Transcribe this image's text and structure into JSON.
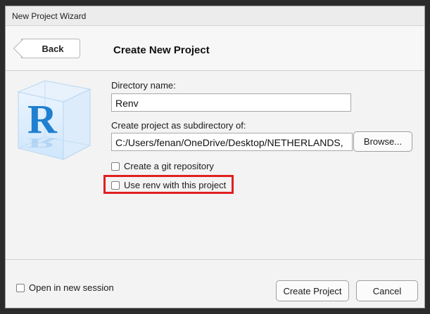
{
  "window": {
    "title": "New Project Wizard"
  },
  "header": {
    "back_label": "Back",
    "title": "Create New Project"
  },
  "logo": {
    "letter": "R"
  },
  "form": {
    "directory_label": "Directory name:",
    "directory_value": "Renv",
    "subdirectory_label": "Create project as subdirectory of:",
    "subdirectory_value": "C:/Users/fenan/OneDrive/Desktop/NETHERLANDS,",
    "browse_label": "Browse...",
    "git_label": "Create a git repository",
    "git_checked": false,
    "renv_label": "Use renv with this project",
    "renv_checked": false
  },
  "footer": {
    "new_session_label": "Open in new session",
    "new_session_checked": false,
    "create_label": "Create Project",
    "cancel_label": "Cancel"
  },
  "colors": {
    "highlight": "#e02020",
    "logo_blue": "#1f7fd0"
  }
}
